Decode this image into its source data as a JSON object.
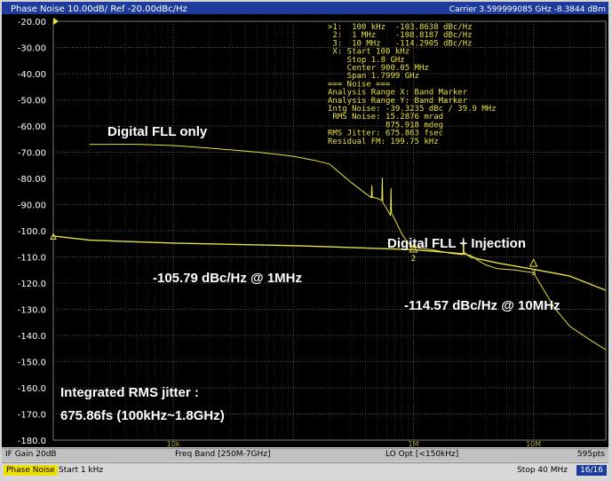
{
  "window": {
    "header_left": "Phase Noise 10.00dB/ Ref -20.00dBc/Hz",
    "header_right": "Carrier 3.599999085 GHz    -8.3844 dBm"
  },
  "marker_readout": {
    "lines": [
      ">1:  100 kHz  -103.8638 dBc/Hz",
      " 2:  1 MHz    -108.8187 dBc/Hz",
      " 3:  10 MHz   -114.2905 dBc/Hz",
      " X: Start 100 kHz",
      "    Stop 1.8 GHz",
      "    Center 900.05 MHz",
      "    Span 1.7999 GHz",
      "=== Noise ===",
      "Analysis Range X: Band Marker",
      "Analysis Range Y: Band Marker",
      "Intg Noise: -39.3235 dBc / 39.9 MHz",
      " RMS Noise: 15.2876 mrad",
      "            875.918 mdeg",
      "RMS Jitter: 675.863 fsec",
      "Residual FM: 199.75 kHz"
    ]
  },
  "annotations": {
    "digital_fll_only": "Digital FLL only",
    "digital_fll_injection": "Digital FLL + Injection",
    "value_1mhz": "-105.79 dBc/Hz @ 1MHz",
    "value_10mhz": "-114.57 dBc/Hz @ 10MHz",
    "jitter_line1": "Integrated RMS jitter :",
    "jitter_line2": "675.86fs (100kHz~1.8GHz)"
  },
  "status_bar_1": {
    "if_gain": "IF Gain 20dB",
    "freq_band": "Freq Band [250M-7GHz]",
    "lo_opt": "LO Opt [<150kHz]",
    "points": "595pts"
  },
  "status_bar_2": {
    "mode": "Phase Noise",
    "start": "Start 1 kHz",
    "stop": "Stop 40 MHz",
    "trace_count": "16/16"
  },
  "colors": {
    "background": "#000000",
    "trace": "#e8e040",
    "grid": "#5a5a50",
    "text": "#ffffff",
    "readout": "#e8e040"
  },
  "chart_data": {
    "type": "line",
    "xscale": "log",
    "xlim": [
      1000,
      40000000
    ],
    "ylim": [
      -180,
      -20
    ],
    "y_ticks": [
      -20,
      -30,
      -40,
      -50,
      -60,
      -70,
      -80,
      -90,
      -100,
      -110,
      -120,
      -130,
      -140,
      -150,
      -160,
      -170,
      -180
    ],
    "y_tick_labels": [
      "-20.00",
      "-30.00",
      "-40.00",
      "-50.00",
      "-60.00",
      "-70.00",
      "-80.00",
      "-90.00",
      "-100.0",
      "-110.0",
      "-120.0",
      "-130.0",
      "-140.0",
      "-150.0",
      "-160.0",
      "-170.0",
      "-180.0"
    ],
    "grid": true,
    "x_tick_labels": [
      "10k",
      "1M",
      "10M"
    ],
    "series": [
      {
        "points": [
          [
            2000,
            -67
          ],
          [
            5000,
            -67.5
          ],
          [
            10000,
            -68
          ],
          [
            20000,
            -68.5
          ],
          [
            50000,
            -69.5
          ],
          [
            100000,
            -71
          ],
          [
            150000,
            -73
          ],
          [
            200000,
            -75
          ],
          [
            300000,
            -82
          ],
          [
            400000,
            -86
          ],
          [
            500000,
            -88
          ],
          [
            600000,
            -91
          ],
          [
            700000,
            -96
          ],
          [
            800000,
            -101
          ],
          [
            900000,
            -104
          ],
          [
            1000000,
            -105.8
          ],
          [
            1200000,
            -107
          ],
          [
            1500000,
            -108
          ],
          [
            2000000,
            -109
          ],
          [
            2600000,
            -108
          ],
          [
            3000000,
            -110
          ],
          [
            3500000,
            -112
          ],
          [
            4000000,
            -113
          ],
          [
            5000000,
            -114
          ],
          [
            7000000,
            -114.5
          ],
          [
            10000000,
            -116
          ],
          [
            15000000,
            -130
          ],
          [
            20000000,
            -137
          ],
          [
            30000000,
            -142
          ],
          [
            40000000,
            -145
          ]
        ],
        "spikes": [
          {
            "x": 450000,
            "base": -87,
            "peak": -82
          },
          {
            "x": 550000,
            "base": -89,
            "peak": -80
          },
          {
            "x": 650000,
            "base": -94,
            "peak": -84
          },
          {
            "x": 2600000,
            "base": -109,
            "peak": -104
          }
        ]
      },
      {
        "points": [
          [
            1000,
            -102
          ],
          [
            2000,
            -103.3
          ],
          [
            10000,
            -104.5
          ],
          [
            50000,
            -105.5
          ],
          [
            100000,
            -106
          ],
          [
            300000,
            -106.5
          ],
          [
            1000000,
            -107
          ],
          [
            2600000,
            -108.5
          ],
          [
            3000000,
            -110
          ],
          [
            5000000,
            -112
          ],
          [
            10000000,
            -114.6
          ],
          [
            20000000,
            -117.5
          ],
          [
            40000000,
            -123
          ]
        ],
        "spikes": [
          {
            "x": 2600000,
            "base": -108.5,
            "peak": -103
          }
        ]
      }
    ],
    "markers": [
      {
        "label": "2",
        "x": 1000000,
        "y": -108.8
      },
      {
        "label": "3",
        "x": 10000000,
        "y": -114.3
      }
    ]
  }
}
